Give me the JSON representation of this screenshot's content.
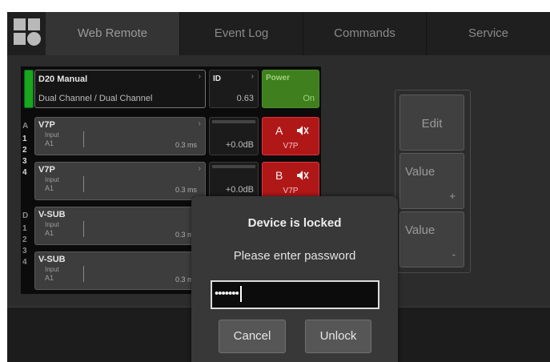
{
  "tabs": [
    {
      "label": "Web Remote",
      "active": true
    },
    {
      "label": "Event Log",
      "active": false
    },
    {
      "label": "Commands",
      "active": false
    },
    {
      "label": "Service",
      "active": false
    }
  ],
  "device": {
    "name": "D20 Manual",
    "mode": "Dual Channel / Dual Channel",
    "id_label": "ID",
    "id_value": "0.63",
    "power_label": "Power",
    "power_value": "On"
  },
  "side_labels": {
    "group_a": [
      "A",
      "1",
      "2",
      "3",
      "4"
    ],
    "group_d": [
      "D",
      "1",
      "2",
      "3",
      "4"
    ]
  },
  "channels": [
    {
      "name": "V7P",
      "sub": "Input",
      "input": "A1",
      "delay": "0.3 ms",
      "gain": "+0.0dB",
      "mute_letter": "A",
      "mute_name": "V7P"
    },
    {
      "name": "V7P",
      "sub": "Input",
      "input": "A1",
      "delay": "0.3 ms",
      "gain": "+0.0dB",
      "mute_letter": "B",
      "mute_name": "V7P"
    },
    {
      "name": "V-SUB",
      "sub": "Input",
      "input": "A1",
      "delay": "0.3 ms"
    },
    {
      "name": "V-SUB",
      "sub": "Input",
      "input": "A1",
      "delay": "0.3 ms"
    }
  ],
  "side_buttons": {
    "edit": "Edit",
    "value_up": "Value",
    "value_up_sign": "+",
    "value_down": "Value",
    "value_down_sign": "-"
  },
  "dialog": {
    "title": "Device is locked",
    "message": "Please enter password",
    "password_mask": "•••••••",
    "cancel": "Cancel",
    "unlock": "Unlock"
  },
  "icons": {
    "chevron": "›",
    "mute": "speaker-muted-icon"
  },
  "colors": {
    "power_green": "#3f7f1e",
    "mute_red": "#b01818",
    "status_green": "#1aa51a"
  }
}
